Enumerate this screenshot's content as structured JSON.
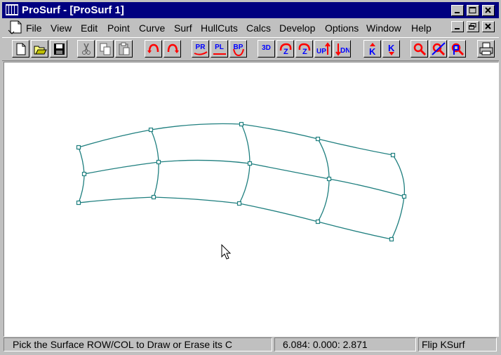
{
  "window": {
    "title": "ProSurf - [ProSurf 1]",
    "controls": {
      "minimize": "minimize",
      "maximize": "maximize",
      "close": "close"
    }
  },
  "menubar": {
    "items": [
      {
        "label": "File",
        "name": "menu-file"
      },
      {
        "label": "View",
        "name": "menu-view"
      },
      {
        "label": "Edit",
        "name": "menu-edit"
      },
      {
        "label": "Point",
        "name": "menu-point"
      },
      {
        "label": "Curve",
        "name": "menu-curve"
      },
      {
        "label": "Surf",
        "name": "menu-surf"
      },
      {
        "label": "HullCuts",
        "name": "menu-hullcuts"
      },
      {
        "label": "Calcs",
        "name": "menu-calcs"
      },
      {
        "label": "Develop",
        "name": "menu-develop"
      },
      {
        "label": "Options",
        "name": "menu-options"
      },
      {
        "label": "Window",
        "name": "menu-window"
      },
      {
        "label": "Help",
        "name": "menu-help"
      }
    ]
  },
  "toolbar": {
    "labels": {
      "pr": "PR",
      "pl": "PL",
      "bp": "BP",
      "view3d": "3D",
      "z1": "Z",
      "z2": "Z",
      "up": "UP",
      "dn": "DN",
      "k1": "K",
      "k2": "K"
    }
  },
  "colors": {
    "surface_line": "#1f7f7f",
    "title_bar": "#000080",
    "tool_red": "#ff0000",
    "tool_blue": "#0000ff"
  },
  "status": {
    "prompt": "Pick the Surface ROW/COL to Draw or Erase its C",
    "coords": "6.084:  0.000:  2.871",
    "mode": "Flip KSurf"
  }
}
